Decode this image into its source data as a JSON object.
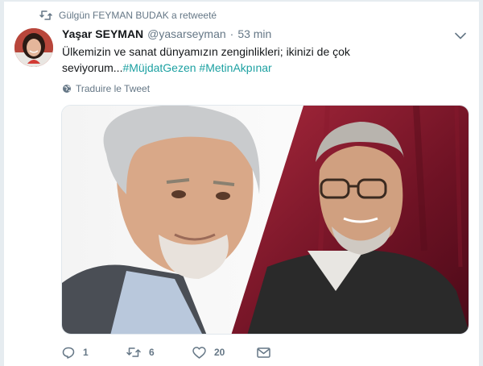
{
  "retweet": {
    "icon": "retweet-icon",
    "text": "Gülgün FEYMAN BUDAK a retweeté"
  },
  "tweet": {
    "author_name": "Yaşar SEYMAN",
    "handle": "@yasarseyman",
    "separator": "·",
    "time": "53 min",
    "text_line1": "Ülkemizin ve sanat dünyamızın zenginlikleri; ikinizi de çok",
    "text_line2_prefix": "seviyorum...",
    "hashtag1": "#MüjdatGezen",
    "hashtag2": "#MetinAkpınar",
    "translate_label": "Traduire le Tweet"
  },
  "actions": {
    "reply_count": "1",
    "retweet_count": "6",
    "like_count": "20"
  },
  "colors": {
    "link": "#1da1a2",
    "muted": "#657786",
    "text": "#14171a",
    "background": "#e6ecf0"
  }
}
